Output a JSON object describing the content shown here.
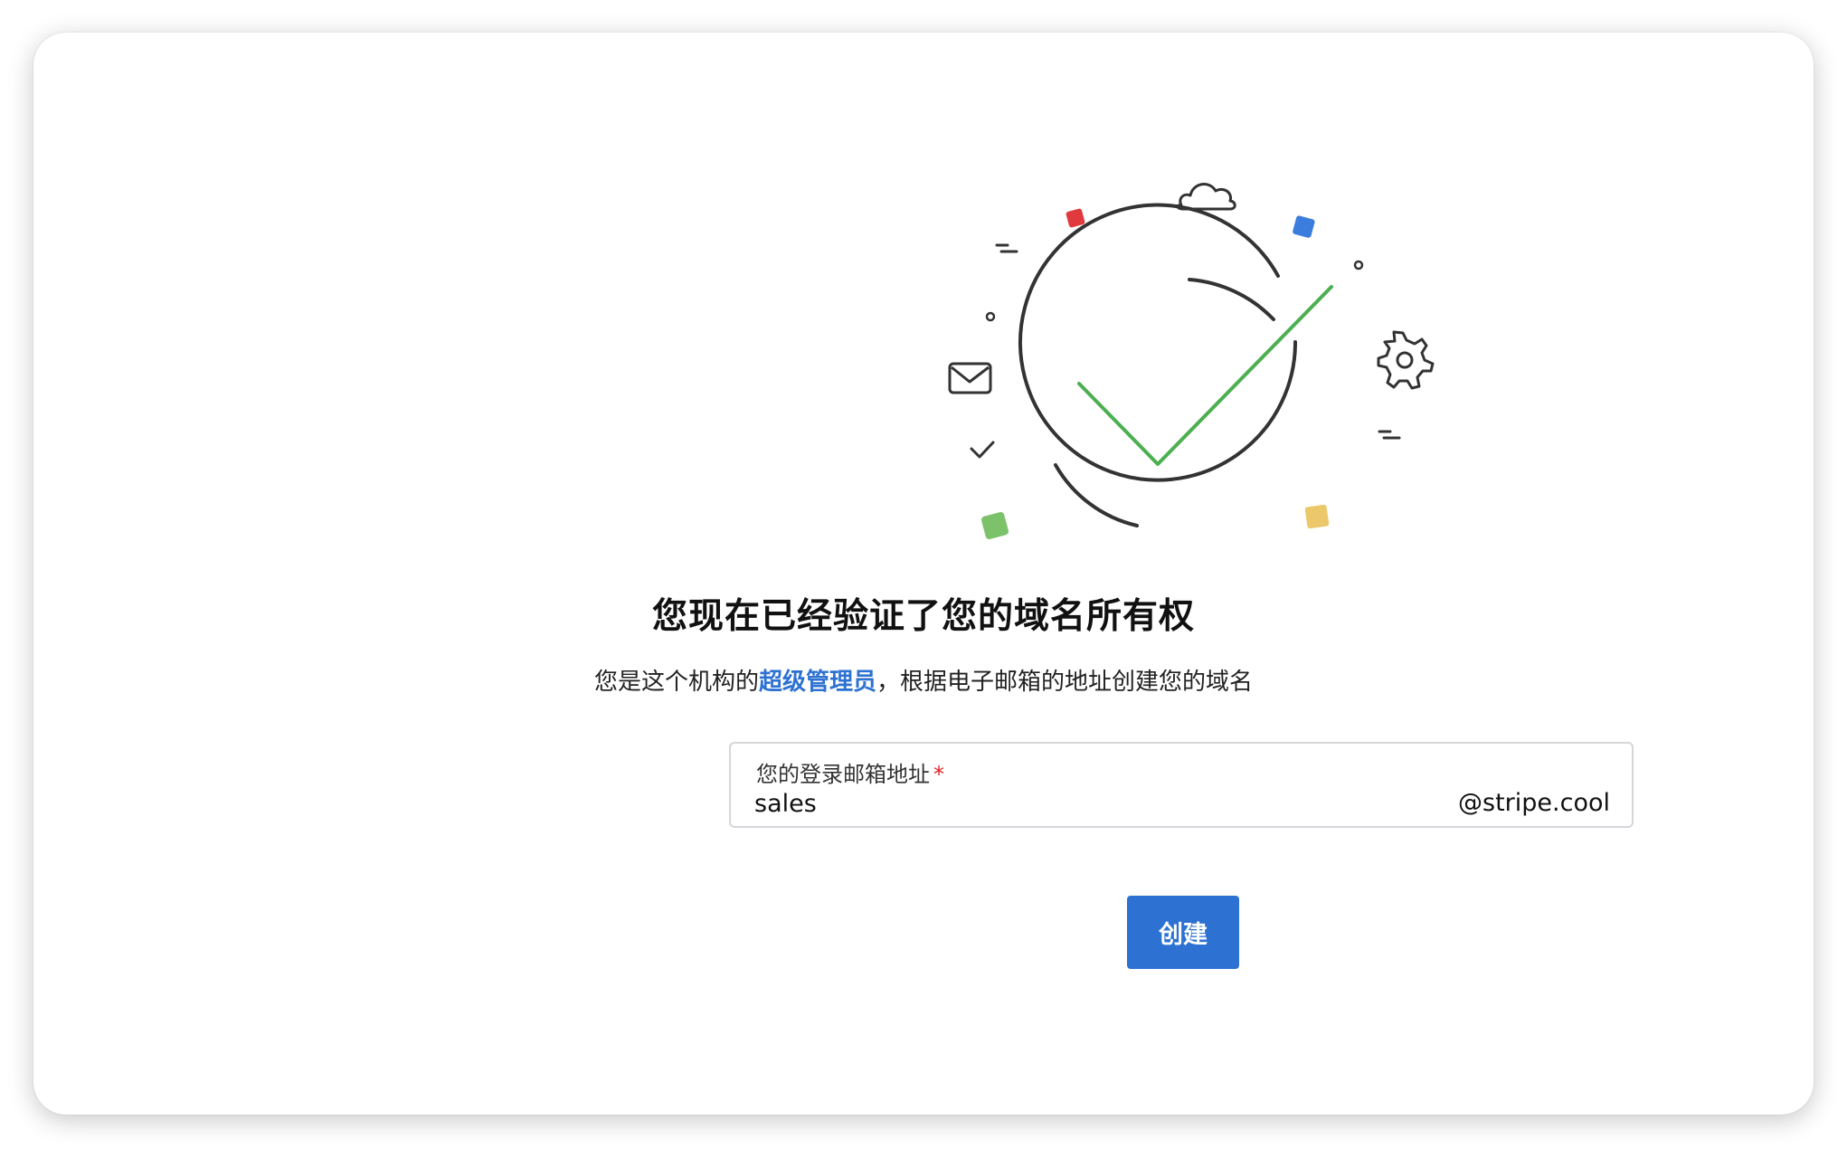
{
  "page": {
    "title": "您现在已经验证了您的域名所有权",
    "subtitle_before": "您是这个机构的",
    "subtitle_role": "超级管理员",
    "subtitle_after": "，根据电子邮箱的地址创建您的域名"
  },
  "form": {
    "email_label": "您的登录邮箱地址",
    "required_mark": "*",
    "email_value": "sales",
    "domain_suffix": "@stripe.cool",
    "create_label": "创建"
  },
  "colors": {
    "accent": "#2d72d2",
    "check": "#4caf50",
    "square_red": "#e0393e",
    "square_blue": "#3b7ddd",
    "square_green": "#7bc26b",
    "square_yellow": "#ecc86a",
    "required": "#e02020"
  },
  "icons": [
    "cloud-icon",
    "mail-icon",
    "gear-icon",
    "small-check-icon",
    "big-check-icon"
  ]
}
